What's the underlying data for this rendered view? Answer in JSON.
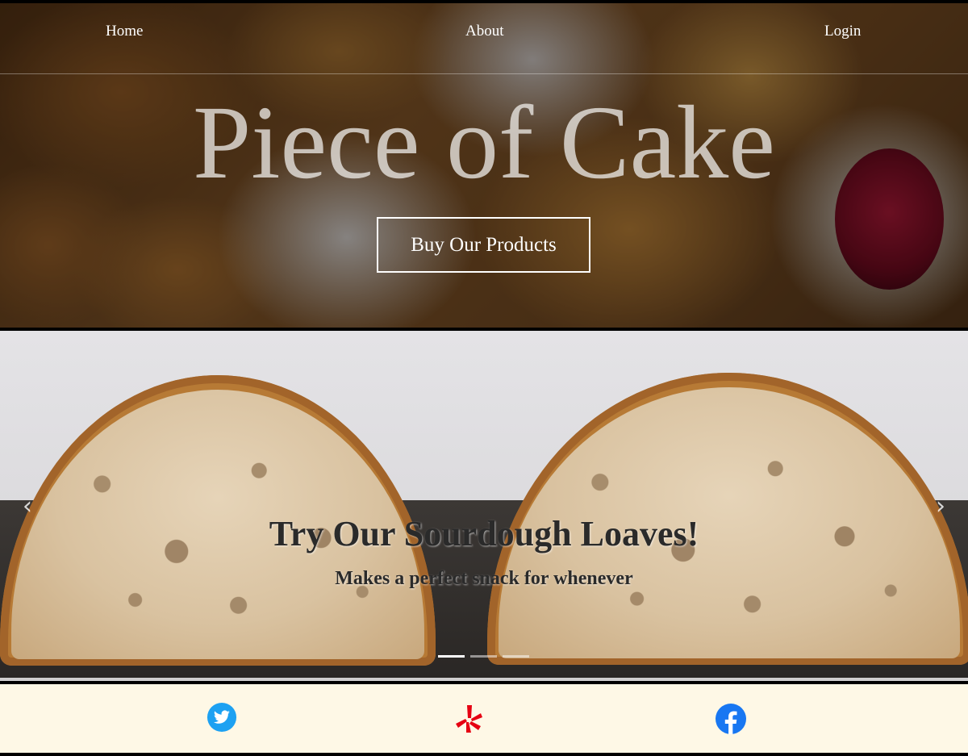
{
  "nav": {
    "home": "Home",
    "about": "About",
    "login": "Login"
  },
  "hero": {
    "title": "Piece of Cake",
    "cta": "Buy Our Products"
  },
  "carousel": {
    "slide_title": "Try Our Sourdough Loaves!",
    "slide_subtitle": "Makes a perfect snack for whenever",
    "prev_icon": "chevron-left-icon",
    "next_icon": "chevron-right-icon",
    "indicator_count": 3,
    "active_index": 0
  },
  "footer": {
    "icons": [
      "twitter-icon",
      "yelp-icon",
      "facebook-icon"
    ],
    "colors": {
      "twitter": "#1da1f2",
      "yelp": "#e60012",
      "facebook": "#1877f2"
    }
  },
  "colors": {
    "footer_bg": "#fef8e6",
    "frame": "#000000"
  }
}
